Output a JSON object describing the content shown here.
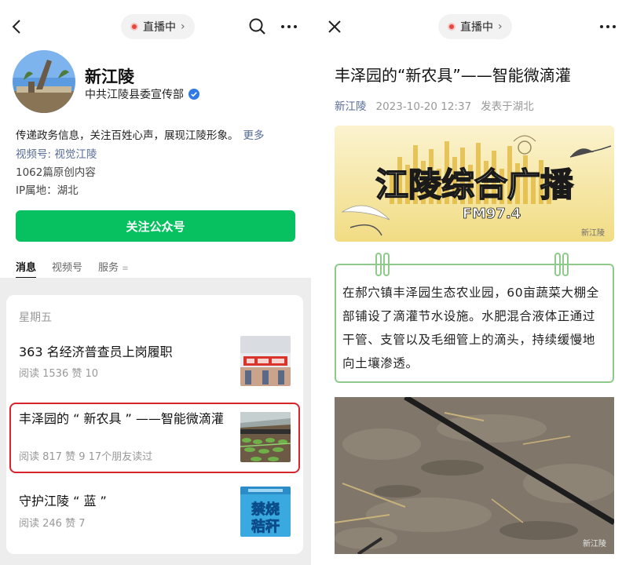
{
  "left": {
    "live_label": "直播中",
    "account": {
      "name": "新江陵",
      "org": "中共江陵县委宣传部",
      "intro": "传递政务信息，关注百姓心声，展现江陵形象。",
      "more": "更多",
      "video_prefix": "视频号:",
      "video_name": "视觉江陵",
      "articles_count": "1062篇原创内容",
      "ip": "IP属地：湖北"
    },
    "follow_label": "关注公众号",
    "tabs": [
      "消息",
      "视频号",
      "服务"
    ],
    "day": "星期五",
    "articles": [
      {
        "title": "363 名经济普查员上岗履职",
        "stats": "阅读 1536   赞 10",
        "thumb_icon": "census-banner-thumbnail"
      },
      {
        "title": "丰泽园的 “ 新农具 ” ——智能微滴灌",
        "stats": "阅读 817   赞 9   17个朋友读过",
        "thumb_icon": "greenhouse-thumbnail"
      },
      {
        "title": "守护江陵 “ 蓝 ”",
        "stats": "阅读 246   赞 7",
        "thumb_icon": "ban-burning-straw-thumbnail",
        "thumb_text_1": "禁烧",
        "thumb_text_2": "秸秆"
      }
    ],
    "highlight_color": "#d9232d"
  },
  "right": {
    "live_label": "直播中",
    "title": "丰泽园的“新农具”——智能微滴灌",
    "source": "新江陵",
    "datetime": "2023-10-20 12:37",
    "location": "发表于湖北",
    "banner": {
      "text": "江陵综合广播",
      "freq": "FM97.4",
      "watermark": "新江陵"
    },
    "callout": "在郝穴镇丰泽园生态农业园，60亩蔬菜大棚全部铺设了滴灌节水设施。水肥混合液体正通过干管、支管以及毛细管上的滴头，持续缓慢地向土壤渗透。",
    "photo_watermark": "新江陵"
  },
  "colors": {
    "accent_green": "#07c160",
    "link_blue": "#576b95",
    "callout_border": "#8ecb8a"
  }
}
